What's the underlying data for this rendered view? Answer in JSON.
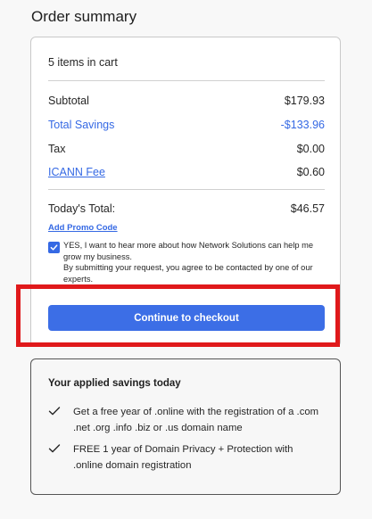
{
  "page": {
    "title": "Order summary"
  },
  "cart": {
    "items_count": "5 items in cart",
    "lines": [
      {
        "label": "Subtotal",
        "value": "$179.93"
      },
      {
        "label": "Total Savings",
        "value": "-$133.96"
      },
      {
        "label": "Tax",
        "value": "$0.00"
      },
      {
        "label": "ICANN Fee",
        "value": "$0.60"
      }
    ],
    "total": {
      "label": "Today's Total:",
      "value": "$46.57"
    },
    "promo_link": "Add Promo Code",
    "consent": {
      "checked": true,
      "line1": "YES, I want to hear more about how Network Solutions can help me grow my business.",
      "line2": "By submitting your request, you agree to be contacted by one of our experts."
    },
    "checkout_label": "Continue to checkout"
  },
  "savings": {
    "title": "Your applied savings today",
    "items": [
      {
        "text": "Get a free year of .online with the registration of a .com .net .org .info .biz or .us domain name"
      },
      {
        "text": "FREE 1 year of Domain Privacy + Protection with .online domain registration"
      }
    ]
  },
  "colors": {
    "accent": "#3569e4",
    "button": "#3c6ee6",
    "highlight": "#e0191b"
  },
  "icons": {
    "check": "checkmark-icon",
    "checkbox": "checkbox-checked-icon"
  }
}
